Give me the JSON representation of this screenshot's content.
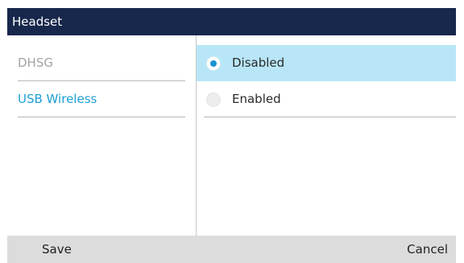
{
  "header": {
    "title": "Headset"
  },
  "menu": {
    "items": [
      {
        "label": "DHSG",
        "state": "inactive"
      },
      {
        "label": "USB Wireless",
        "state": "focused"
      }
    ]
  },
  "options": {
    "selected": "Disabled",
    "items": [
      {
        "label": "Disabled",
        "checked": true
      },
      {
        "label": "Enabled",
        "checked": false
      }
    ]
  },
  "softkeys": {
    "save": "Save",
    "cancel": "Cancel"
  },
  "colors": {
    "header_bg": "#17284c",
    "highlight_bg": "#b8e6f7",
    "focused_text": "#1e9fd5",
    "radio_selected": "#1b93d0",
    "footer_bg": "#dcdcdc"
  }
}
